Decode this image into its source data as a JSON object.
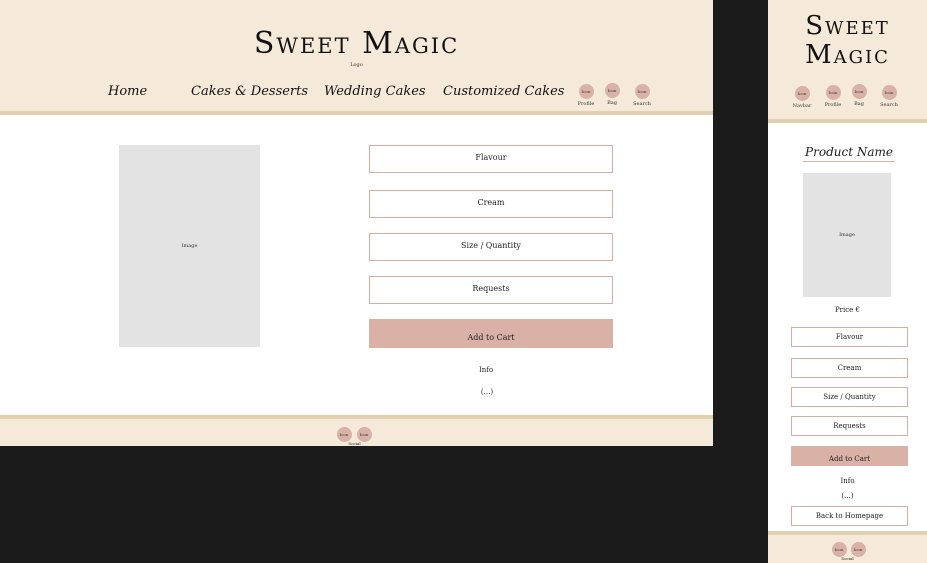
{
  "brand": {
    "name": "Sweet Magic",
    "logo_caption": "Logo"
  },
  "nav": {
    "home": "Home",
    "cakes_desserts": "Cakes & Desserts",
    "wedding_cakes": "Wedding Cakes",
    "customized_cakes": "Customized Cakes"
  },
  "icons": {
    "placeholder": "Icon",
    "profile": "Profile",
    "bag": "Bag",
    "search": "Search",
    "navbar": "Navbar",
    "social": "Social"
  },
  "product": {
    "image_caption": "Image",
    "name": "Product Name",
    "price": "Price €",
    "flavour": "Flavour",
    "cream": "Cream",
    "size_quantity": "Size / Quantity",
    "requests": "Requests",
    "add_to_cart": "Add to Cart",
    "info_title": "Info",
    "info_body": "(...)",
    "back_home": "Back to Homepage"
  },
  "colors": {
    "header_bg": "#f5e9d9",
    "divider": "#e0d2b0",
    "accent": "#d9b1a6",
    "image_placeholder": "#e3e3e3",
    "outside_bg": "#1b1b1b"
  }
}
